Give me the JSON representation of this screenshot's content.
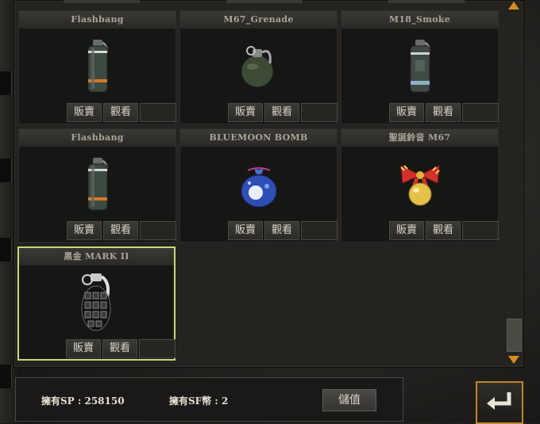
{
  "items": [
    {
      "name": "Flashbang",
      "sell_label": "販賣",
      "view_label": "觀看",
      "icon": "flashbang-grenade-icon",
      "selected": false
    },
    {
      "name": "M67_Grenade",
      "sell_label": "販賣",
      "view_label": "觀看",
      "icon": "frag-grenade-icon",
      "selected": false
    },
    {
      "name": "M18_Smoke",
      "sell_label": "販賣",
      "view_label": "觀看",
      "icon": "smoke-grenade-icon",
      "selected": false
    },
    {
      "name": "Flashbang",
      "sell_label": "販賣",
      "view_label": "觀看",
      "icon": "flashbang-grenade-icon",
      "selected": false
    },
    {
      "name": "BLUEMOON BOMB",
      "sell_label": "販賣",
      "view_label": "觀看",
      "icon": "bluemoon-bomb-icon",
      "selected": false
    },
    {
      "name": "聖誕鈴音 M67",
      "sell_label": "販賣",
      "view_label": "觀看",
      "icon": "christmas-bell-grenade-icon",
      "selected": false
    },
    {
      "name": "黑金 MARK II",
      "sell_label": "販賣",
      "view_label": "觀看",
      "icon": "black-gold-mark2-grenade-icon",
      "selected": true
    }
  ],
  "status": {
    "sp_text": "擁有SP : 258150",
    "sf_text": "擁有SF幣 : 2",
    "recharge_label": "儲值"
  },
  "colors": {
    "selection_border": "#c8d87a",
    "scroll_arrow": "#d98a1f",
    "return_border": "#c1852b"
  }
}
